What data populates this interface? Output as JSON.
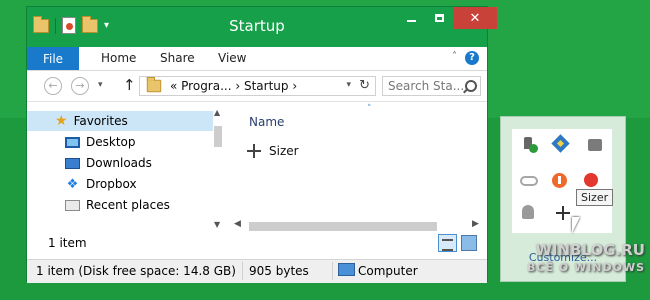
{
  "window": {
    "title": "Startup",
    "close_symbol": "✕"
  },
  "ribbon": {
    "tabs": [
      "File",
      "Home",
      "Share",
      "View"
    ],
    "help_symbol": "?",
    "collapse_symbol": "˄"
  },
  "navbar": {
    "back_symbol": "←",
    "forward_symbol": "→",
    "dropdown_symbol": "▾",
    "up_symbol": "↑",
    "address": "«  Progra...  ›  Startup  ›",
    "refresh_symbol": "↻",
    "search_placeholder": "Search Sta..."
  },
  "navigation_pane": {
    "favorites_label": "Favorites",
    "items": [
      "Desktop",
      "Downloads",
      "Dropbox",
      "Recent places"
    ]
  },
  "file_list": {
    "column_name": "Name",
    "sort_indicator": "˄",
    "files": [
      {
        "name": "Sizer"
      }
    ],
    "item_count": "1 item"
  },
  "statusbar": {
    "info": "1 item (Disk free space: 14.8 GB)",
    "size": "905 bytes",
    "location": "Computer"
  },
  "tray_popup": {
    "tooltip": "Sizer",
    "link": "Customize..."
  },
  "watermark": {
    "title": "WINBLOG.RU",
    "subtitle": "ВСЁ О WINDOWS"
  },
  "colors": {
    "background": "#1e9a3e",
    "accent": "#1979ca",
    "close_button": "#c9423a",
    "selection": "#cde6f7"
  }
}
